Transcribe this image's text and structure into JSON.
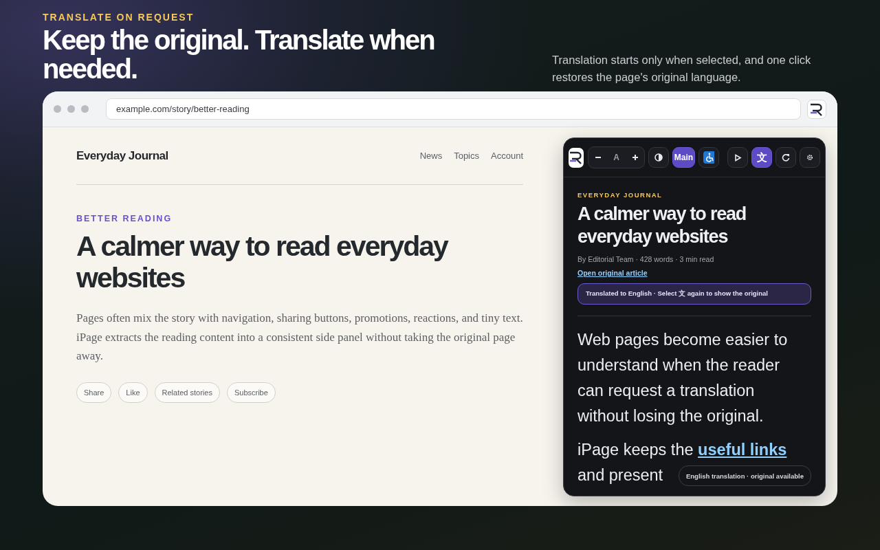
{
  "hero": {
    "eyebrow": "TRANSLATE ON REQUEST",
    "headline": "Keep the original. Translate when needed.",
    "description": "Translation starts only when selected, and one click restores the page's original language."
  },
  "browser": {
    "url": "example.com/story/better-reading"
  },
  "site": {
    "brand": "Everyday Journal",
    "nav": [
      {
        "label": "News"
      },
      {
        "label": "Topics"
      },
      {
        "label": "Account"
      }
    ],
    "kicker": "BETTER READING",
    "title": "A calmer way to read everyday websites",
    "lede": "Pages often mix the story with navigation, sharing buttons, promotions, reactions, and tiny text. iPage extracts the reading content into a consistent side panel without taking the original page away.",
    "actions": [
      {
        "label": "Share"
      },
      {
        "label": "Like"
      },
      {
        "label": "Related stories"
      },
      {
        "label": "Subscribe"
      }
    ]
  },
  "panel": {
    "toolbar": [
      {
        "kind": "font-size",
        "items": [
          {
            "kind": "minus"
          },
          {
            "kind": "text",
            "label": "A"
          },
          {
            "kind": "plus"
          }
        ]
      },
      {
        "kind": "contrast",
        "selected": false
      },
      {
        "kind": "text",
        "label": "Main",
        "selected": true
      },
      {
        "kind": "accessibility",
        "selected": false
      },
      {
        "kind": "play",
        "selected": false
      },
      {
        "kind": "text",
        "label": "文",
        "selected": true
      },
      {
        "kind": "refresh",
        "selected": false
      },
      {
        "kind": "settings",
        "selected": false
      }
    ],
    "source": "EVERYDAY JOURNAL",
    "title": "A calmer way to read everyday websites",
    "meta": "By Editorial Team · 428 words · 3 min read",
    "original_link": "Open original article",
    "notice": "Translated to English · Select 文 again to show the original",
    "paragraphs": [
      {
        "text": "Web pages become easier to understand when the reader can request a translation without losing the original."
      },
      {
        "text": "iPage keeps the ",
        "link": "useful links",
        "continuation": "and present"
      }
    ],
    "status": "English translation · original available"
  }
}
